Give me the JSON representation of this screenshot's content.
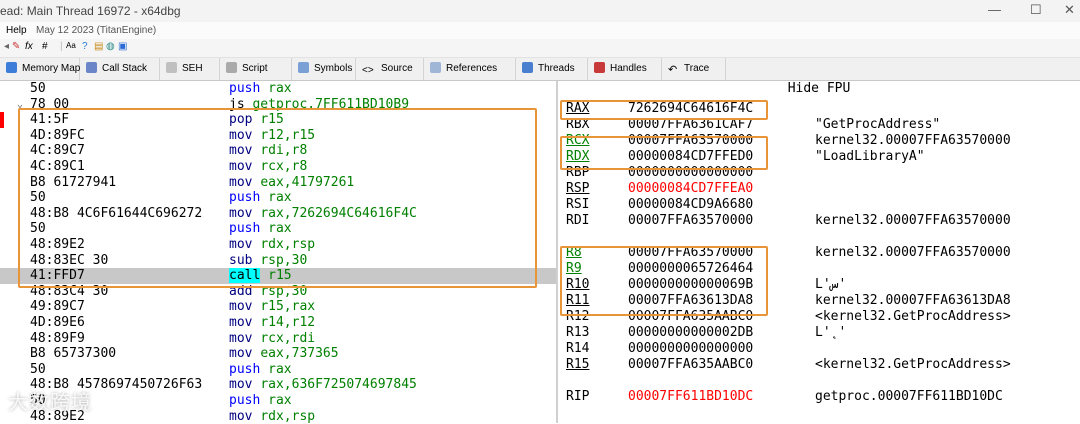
{
  "window": {
    "title": "ead: Main Thread 16972 - x64dbg"
  },
  "menu": {
    "help": "Help",
    "date": "May 12 2023 (TitanEngine)"
  },
  "toolbar": {
    "fx": "fx",
    "hash": "#",
    "aa": "Aa"
  },
  "tabs": [
    "Memory Map",
    "Call Stack",
    "SEH",
    "Script",
    "Symbols",
    "Source",
    "References",
    "Threads",
    "Handles",
    "Trace"
  ],
  "disasm": [
    {
      "bytes": "50",
      "mnemonic": "push",
      "operands": "rax",
      "kind": "push"
    },
    {
      "bytes": "78 00",
      "mnemonic": "js",
      "operands": "getproc.7FF611BD10B9",
      "kind": "jmp",
      "arrow": true
    },
    {
      "bytes": "41:5F",
      "mnemonic": "pop",
      "operands": "r15",
      "kind": "normal",
      "bp": true
    },
    {
      "bytes": "4D:89FC",
      "mnemonic": "mov",
      "operands": "r12,r15",
      "kind": "normal"
    },
    {
      "bytes": "4C:89C7",
      "mnemonic": "mov",
      "operands": "rdi,r8",
      "kind": "normal"
    },
    {
      "bytes": "4C:89C1",
      "mnemonic": "mov",
      "operands": "rcx,r8",
      "kind": "normal"
    },
    {
      "bytes": "B8 61727941",
      "mnemonic": "mov",
      "operands": "eax,41797261",
      "kind": "normal"
    },
    {
      "bytes": "50",
      "mnemonic": "push",
      "operands": "rax",
      "kind": "push"
    },
    {
      "bytes": "48:B8 4C6F61644C696272",
      "mnemonic": "mov",
      "operands": "rax,7262694C64616F4C",
      "kind": "normal"
    },
    {
      "bytes": "50",
      "mnemonic": "push",
      "operands": "rax",
      "kind": "push"
    },
    {
      "bytes": "48:89E2",
      "mnemonic": "mov",
      "operands": "rdx,rsp",
      "kind": "normal"
    },
    {
      "bytes": "48:83EC 30",
      "mnemonic": "sub",
      "operands": "rsp,30",
      "kind": "normal"
    },
    {
      "bytes": "41:FFD7",
      "mnemonic": "call",
      "operands": "r15",
      "kind": "call",
      "selected": true
    },
    {
      "bytes": "48:83C4 30",
      "mnemonic": "add",
      "operands": "rsp,30",
      "kind": "normal"
    },
    {
      "bytes": "49:89C7",
      "mnemonic": "mov",
      "operands": "r15,rax",
      "kind": "normal"
    },
    {
      "bytes": "4D:89E6",
      "mnemonic": "mov",
      "operands": "r14,r12",
      "kind": "normal"
    },
    {
      "bytes": "48:89F9",
      "mnemonic": "mov",
      "operands": "rcx,rdi",
      "kind": "normal"
    },
    {
      "bytes": "B8 65737300",
      "mnemonic": "mov",
      "operands": "eax,737365",
      "kind": "normal"
    },
    {
      "bytes": "50",
      "mnemonic": "push",
      "operands": "rax",
      "kind": "push"
    },
    {
      "bytes": "48:B8 4578697450726F63",
      "mnemonic": "mov",
      "operands": "rax,636F725074697845",
      "kind": "normal"
    },
    {
      "bytes": "50",
      "mnemonic": "push",
      "operands": "rax",
      "kind": "push"
    },
    {
      "bytes": "48:89E2",
      "mnemonic": "mov",
      "operands": "rdx,rsp",
      "kind": "normal"
    }
  ],
  "registers_header": "Hide FPU",
  "registers": [
    {
      "name": "RAX",
      "value": "7262694C64616F4C",
      "comment": "",
      "style": "under"
    },
    {
      "name": "RBX",
      "value": "00007FFA6361CAF7",
      "comment": "\"GetProcAddress\"",
      "style": ""
    },
    {
      "name": "RCX",
      "value": "00007FFA63570000",
      "comment": "kernel32.00007FFA63570000",
      "style": "green"
    },
    {
      "name": "RDX",
      "value": "00000084CD7FFED0",
      "comment": "\"LoadLibraryA\"",
      "style": "green"
    },
    {
      "name": "RBP",
      "value": "0000000000000000",
      "comment": "",
      "style": ""
    },
    {
      "name": "RSP",
      "value": "00000084CD7FFEA0",
      "comment": "",
      "style": "under",
      "red": true
    },
    {
      "name": "RSI",
      "value": "00000084CD9A6680",
      "comment": "",
      "style": ""
    },
    {
      "name": "RDI",
      "value": "00007FFA63570000",
      "comment": "kernel32.00007FFA63570000",
      "style": ""
    },
    {
      "name": "R8",
      "value": "00007FFA63570000",
      "comment": "kernel32.00007FFA63570000",
      "style": "green",
      "gap": true
    },
    {
      "name": "R9",
      "value": "0000000065726464",
      "comment": "",
      "style": "green"
    },
    {
      "name": "R10",
      "value": "000000000000069B",
      "comment": "L'س'",
      "style": "under"
    },
    {
      "name": "R11",
      "value": "00007FFA63613DA8",
      "comment": "kernel32.00007FFA63613DA8",
      "style": "under"
    },
    {
      "name": "R12",
      "value": "00007FFA635AABC0",
      "comment": "<kernel32.GetProcAddress>",
      "style": ""
    },
    {
      "name": "R13",
      "value": "00000000000002DB",
      "comment": "L'˛'",
      "style": ""
    },
    {
      "name": "R14",
      "value": "0000000000000000",
      "comment": "",
      "style": ""
    },
    {
      "name": "R15",
      "value": "00007FFA635AABC0",
      "comment": "<kernel32.GetProcAddress>",
      "style": "under"
    },
    {
      "name": "RIP",
      "value": "00007FF611BD10DC",
      "comment": "getproc.00007FF611BD10DC",
      "style": "",
      "red": true,
      "gap": true
    }
  ],
  "watermark": "大数跨境",
  "colors": {
    "highlight_box": "#e8953a",
    "call_highlight": "#00ffff",
    "selection": "#c8c8c8"
  }
}
